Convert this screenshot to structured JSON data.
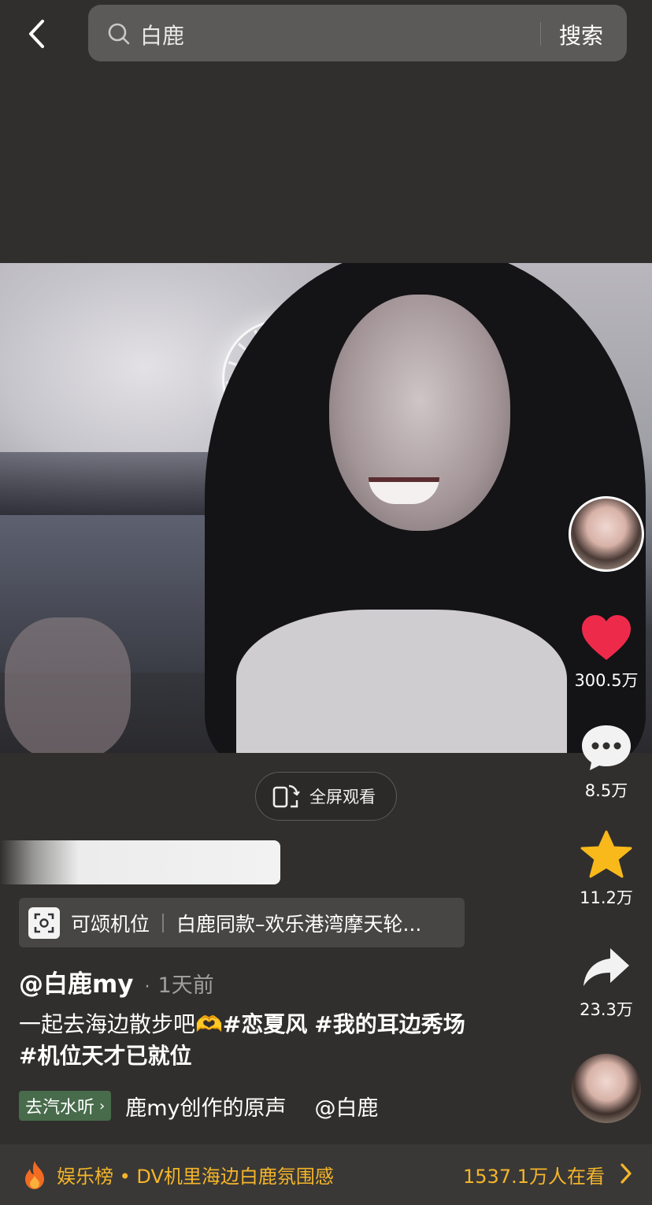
{
  "search": {
    "query": "白鹿",
    "button_label": "搜索"
  },
  "icons": {
    "back": "back-arrow-icon",
    "search": "search-icon",
    "fullscreen": "fullscreen-icon",
    "like": "heart-icon",
    "comment": "comment-icon",
    "favorite": "star-icon",
    "share": "share-icon",
    "spot": "scan-icon",
    "hot": "fire-icon"
  },
  "video": {
    "fullscreen_label": "全屏观看"
  },
  "spot_tag": {
    "label": "可颂机位",
    "description": "白鹿同款–欢乐港湾摩天轮..."
  },
  "post": {
    "author": "@白鹿my",
    "time": "1天前",
    "caption_text": "一起去海边散步吧🫶",
    "hashtags": [
      "#恋夏风",
      "#我的耳边秀场",
      "#机位天才已就位"
    ]
  },
  "music": {
    "button_label": "去汽水听",
    "track": "鹿my创作的原声",
    "user": "@白鹿"
  },
  "actions": {
    "likes": "300.5万",
    "comments": "8.5万",
    "favorites": "11.2万",
    "shares": "23.3万"
  },
  "banner": {
    "text": "娱乐榜 • DV机里海边白鹿氛围感",
    "viewers": "1537.1万人在看"
  },
  "colors": {
    "background": "#302f2d",
    "like": "#ee2a4a",
    "favorite": "#f9b91b",
    "banner_accent": "#f5b52a",
    "music_button": "#476b4b"
  }
}
